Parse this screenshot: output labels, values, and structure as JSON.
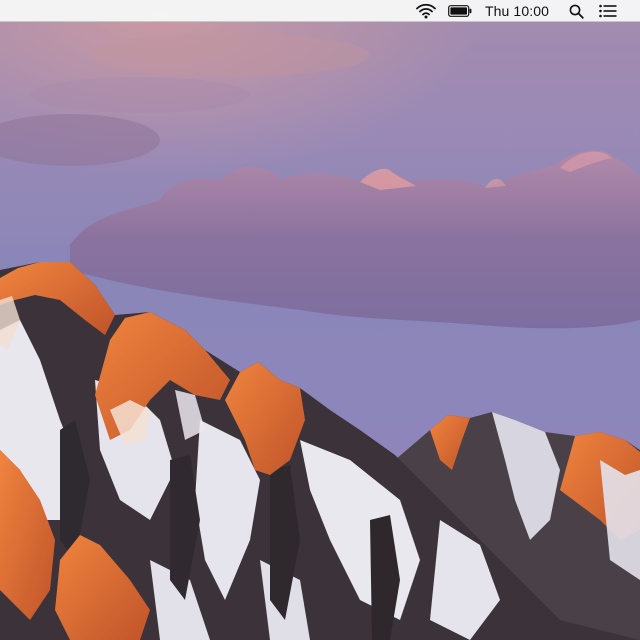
{
  "menubar": {
    "clock": "Thu 10:00",
    "status_icons": [
      "wifi-icon",
      "battery-icon",
      "spotlight-search-icon",
      "notification-center-icon"
    ]
  },
  "desktop": {
    "wallpaper": "sierra-mountains-sunset"
  },
  "colors": {
    "menubar_bg": "#f6f6f6",
    "menubar_text": "#111111",
    "sky_top": "#9c88b2",
    "sky_mid": "#8a82b4",
    "cloud": "#8a6f9a",
    "peak_glow": "#e8763a",
    "rock": "#3a3438",
    "snow": "#e9e8ef"
  }
}
